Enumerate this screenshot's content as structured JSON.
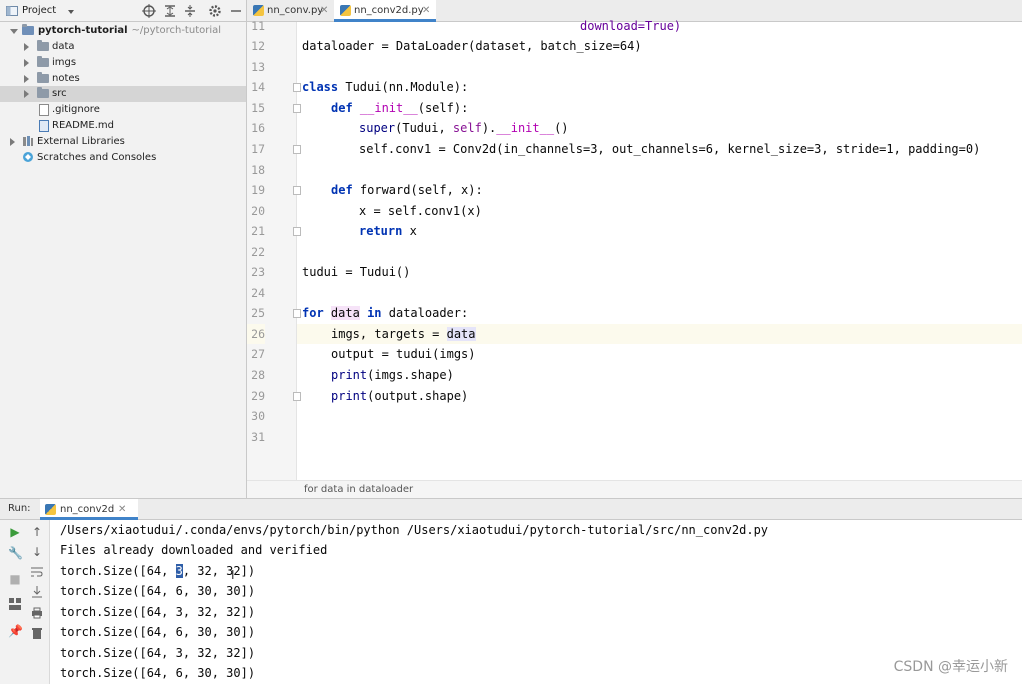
{
  "project_panel": {
    "title": "Project",
    "toolbar_icons": [
      "target-icon",
      "expand-icon",
      "collapse-icon",
      "gear-icon",
      "minimize-icon"
    ],
    "tree": [
      {
        "label": "pytorch-tutorial",
        "path": "~/pytorch-tutorial",
        "type": "root"
      },
      {
        "label": "data",
        "type": "folder"
      },
      {
        "label": "imgs",
        "type": "folder"
      },
      {
        "label": "notes",
        "type": "folder"
      },
      {
        "label": "src",
        "type": "folder",
        "selected": true
      },
      {
        "label": ".gitignore",
        "type": "file"
      },
      {
        "label": "README.md",
        "type": "file"
      },
      {
        "label": "External Libraries",
        "type": "library"
      },
      {
        "label": "Scratches and Consoles",
        "type": "scratches"
      }
    ]
  },
  "editor": {
    "tabs": [
      {
        "label": "nn_conv.py",
        "active": false
      },
      {
        "label": "nn_conv2d.py",
        "active": true
      }
    ],
    "line_numbers": [
      "11",
      "12",
      "13",
      "14",
      "15",
      "16",
      "17",
      "18",
      "19",
      "20",
      "21",
      "22",
      "23",
      "24",
      "25",
      "26",
      "27",
      "28",
      "29",
      "30",
      "31"
    ],
    "current_line": "26",
    "code": {
      "l11": "download=True)",
      "l12": "dataloader = DataLoader(dataset, batch_size=64)",
      "l14_kw": "class",
      "l14_rest": " Tudui(nn.Module):",
      "l15_kw": "def",
      "l15_fn": " __init__",
      "l15_rest": "(self):",
      "l16_a": "super",
      "l16_b": "(Tudui, ",
      "l16_c": "self",
      "l16_d": ").",
      "l16_e": "__init__",
      "l16_f": "()",
      "l17": "self.conv1 = Conv2d(in_channels=3, out_channels=6, kernel_size=3, stride=1, padding=0)",
      "l19_kw": "def",
      "l19_rest": " forward(self, x):",
      "l20": "x = self.conv1(x)",
      "l21_kw": "return",
      "l21_rest": " x",
      "l23": "tudui = Tudui()",
      "l25_kw": "for",
      "l25_var": "data",
      "l25_in": "in",
      "l25_rest": " dataloader:",
      "l26_a": "imgs, targets = ",
      "l26_b": "data",
      "l27": "output = tudui(imgs)",
      "l28_a": "print",
      "l28_b": "(imgs.shape)",
      "l29_a": "print",
      "l29_b": "(output.shape)"
    },
    "breadcrumb": "for data in dataloader"
  },
  "run_panel": {
    "label": "Run:",
    "tab": "nn_conv2d",
    "side_icons": [
      "run-icon",
      "wrench-icon",
      "stop-icon",
      "layout-icon",
      "pin-icon",
      "up-icon",
      "down-icon",
      "wrap-icon",
      "scroll-end-icon",
      "print-icon",
      "trash-icon"
    ],
    "output": {
      "l1": "/Users/xiaotudui/.conda/envs/pytorch/bin/python /Users/xiaotudui/pytorch-tutorial/src/nn_conv2d.py",
      "l2": "Files already downloaded and verified",
      "l3_a": "torch.Size([64, ",
      "l3_sel": "3",
      "l3_b": ", 32, 32])",
      "l4": "torch.Size([64, 6, 30, 30])",
      "l5": "torch.Size([64, 3, 32, 32])",
      "l6": "torch.Size([64, 6, 30, 30])",
      "l7": "torch.Size([64, 3, 32, 32])",
      "l8": "torch.Size([64, 6, 30, 30])"
    }
  },
  "watermark": "CSDN @幸运小新"
}
